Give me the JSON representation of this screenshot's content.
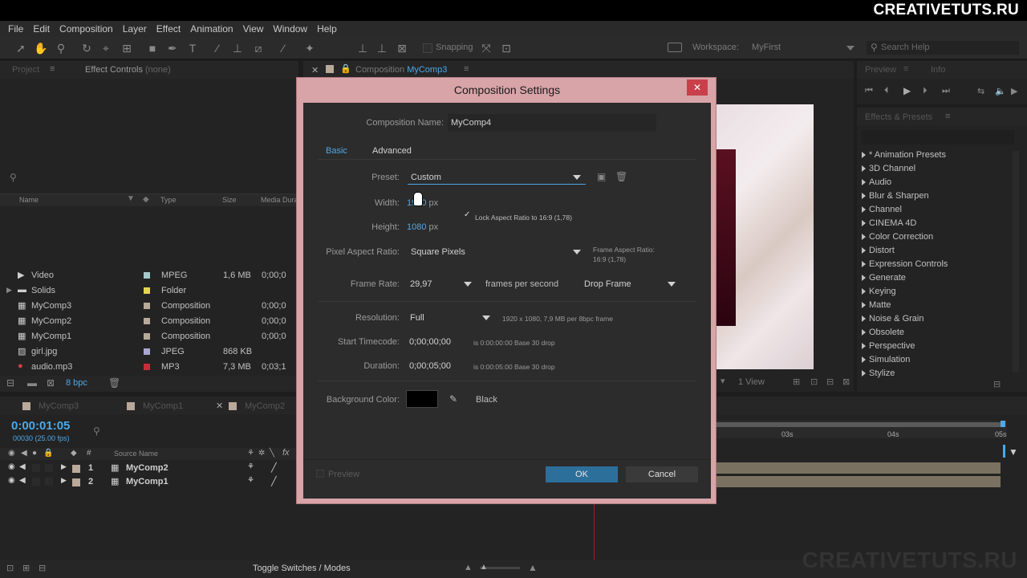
{
  "brand": "CREATIVETUTS.RU",
  "watermark": "CREATIVETUTS.RU",
  "menu": [
    "File",
    "Edit",
    "Composition",
    "Layer",
    "Effect",
    "Animation",
    "View",
    "Window",
    "Help"
  ],
  "toolbar": {
    "snapping_label": "Snapping",
    "workspace_label": "Workspace:",
    "workspace_value": "MyFirst",
    "search_placeholder": "Search Help"
  },
  "project_panel": {
    "tab_project": "Project",
    "tab_effect_controls": "Effect Controls",
    "effect_controls_value": "(none)",
    "columns": {
      "name": "Name",
      "type": "Type",
      "size": "Size",
      "media_duration": "Media Dura"
    },
    "items": [
      {
        "name": "Video",
        "type": "MPEG",
        "size": "1,6 MB",
        "dur": "0;00;0",
        "swatch": "#a6c8c8",
        "icon": "video-file-icon"
      },
      {
        "name": "Solids",
        "type": "Folder",
        "size": "",
        "dur": "",
        "swatch": "#e3d64a",
        "icon": "folder-icon"
      },
      {
        "name": "MyComp3",
        "type": "Composition",
        "size": "",
        "dur": "0;00;0",
        "swatch": "#b8a99a",
        "icon": "composition-icon"
      },
      {
        "name": "MyComp2",
        "type": "Composition",
        "size": "",
        "dur": "0;00;0",
        "swatch": "#b8a99a",
        "icon": "composition-icon"
      },
      {
        "name": "MyComp1",
        "type": "Composition",
        "size": "",
        "dur": "0;00;0",
        "swatch": "#b8a99a",
        "icon": "composition-icon"
      },
      {
        "name": "girl.jpg",
        "type": "JPEG",
        "size": "868 KB",
        "dur": "",
        "swatch": "#a9a6d0",
        "icon": "image-file-icon"
      },
      {
        "name": "audio.mp3",
        "type": "MP3",
        "size": "7,3 MB",
        "dur": "0;03;1",
        "swatch": "#c0303a",
        "icon": "audio-file-icon"
      }
    ],
    "bpc": "8 bpc"
  },
  "comp_panel": {
    "tab_label": "Composition",
    "tab_name": "MyComp3",
    "view_label": "1 View"
  },
  "preview_panel": {
    "tab_preview": "Preview",
    "tab_info": "Info"
  },
  "effects_panel": {
    "title": "Effects & Presets",
    "items": [
      "* Animation Presets",
      "3D Channel",
      "Audio",
      "Blur & Sharpen",
      "Channel",
      "CINEMA 4D",
      "Color Correction",
      "Distort",
      "Expression Controls",
      "Generate",
      "Keying",
      "Matte",
      "Noise & Grain",
      "Obsolete",
      "Perspective",
      "Simulation",
      "Stylize"
    ]
  },
  "timeline": {
    "tabs": [
      "MyComp3",
      "MyComp1",
      "MyComp2"
    ],
    "timecode": "0:00:01:05",
    "frames": "00030 (25.00 fps)",
    "source_name_header": "Source Name",
    "ruler": [
      "03s",
      "04s",
      "05s"
    ],
    "layers": [
      {
        "num": "1",
        "name": "MyComp2"
      },
      {
        "num": "2",
        "name": "MyComp1"
      }
    ],
    "toggle_label": "Toggle Switches / Modes"
  },
  "dialog": {
    "title": "Composition Settings",
    "comp_name_label": "Composition Name:",
    "comp_name_value": "MyComp4",
    "tab_basic": "Basic",
    "tab_advanced": "Advanced",
    "preset_label": "Preset:",
    "preset_value": "Custom",
    "width_label": "Width:",
    "width_value": "1920",
    "width_unit": "px",
    "height_label": "Height:",
    "height_value": "1080",
    "height_unit": "px",
    "lock_aspect": "Lock Aspect Ratio to 16:9 (1,78)",
    "lock_aspect_checked": true,
    "par_label": "Pixel Aspect Ratio:",
    "par_value": "Square Pixels",
    "frame_aspect_label": "Frame Aspect Ratio:",
    "frame_aspect_value": "16:9 (1,78)",
    "frame_rate_label": "Frame Rate:",
    "frame_rate_value": "29,97",
    "fps_label": "frames per second",
    "drop_frame_value": "Drop Frame",
    "resolution_label": "Resolution:",
    "resolution_value": "Full",
    "resolution_info": "1920 x 1080, 7,9 MB per 8bpc frame",
    "start_tc_label": "Start Timecode:",
    "start_tc_value": "0;00;00;00",
    "start_tc_info": "is 0:00:00:00  Base 30  drop",
    "duration_label": "Duration:",
    "duration_value": "0;00;05;00",
    "duration_info": "is 0:00:05:00  Base 30  drop",
    "bg_color_label": "Background Color:",
    "bg_color_name": "Black",
    "bg_color_hex": "#000000",
    "preview_label": "Preview",
    "ok_label": "OK",
    "cancel_label": "Cancel"
  }
}
